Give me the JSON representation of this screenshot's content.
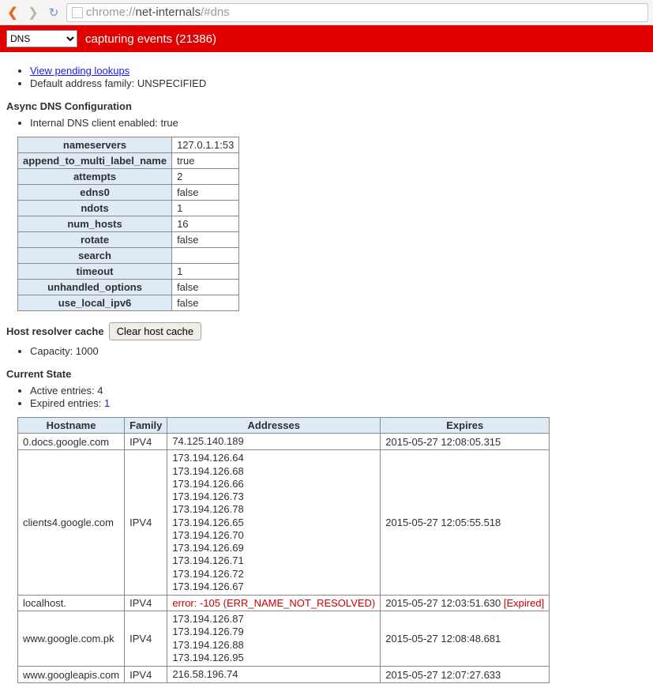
{
  "chrome_bar": {
    "url_grey": "chrome://",
    "url_dark": "net-internals",
    "url_rest": "/#dns"
  },
  "ribbon": {
    "select_value": "DNS",
    "status": "capturing events (21386)"
  },
  "top_list": {
    "link_pending": "View pending lookups",
    "family_line_prefix": "Default address family: ",
    "family_value": "UNSPECIFIED"
  },
  "async_heading": "Async DNS Configuration",
  "internal_client_line": "Internal DNS client enabled: true",
  "kv": [
    {
      "k": "nameservers",
      "v": "127.0.1.1:53"
    },
    {
      "k": "append_to_multi_label_name",
      "v": "true"
    },
    {
      "k": "attempts",
      "v": "2"
    },
    {
      "k": "edns0",
      "v": "false"
    },
    {
      "k": "ndots",
      "v": "1"
    },
    {
      "k": "num_hosts",
      "v": "16"
    },
    {
      "k": "rotate",
      "v": "false"
    },
    {
      "k": "search",
      "v": ""
    },
    {
      "k": "timeout",
      "v": "1"
    },
    {
      "k": "unhandled_options",
      "v": "false"
    },
    {
      "k": "use_local_ipv6",
      "v": "false"
    }
  ],
  "resolver": {
    "heading": "Host resolver cache",
    "button": "Clear host cache",
    "capacity_line": "Capacity: 1000"
  },
  "state_heading": "Current State",
  "entries": {
    "active_label": "Active entries: ",
    "active_val": "4",
    "expired_label": "Expired entries: ",
    "expired_val": "1"
  },
  "grid": {
    "headers": [
      "Hostname",
      "Family",
      "Addresses",
      "Expires"
    ],
    "rows": [
      {
        "host": "0.docs.google.com",
        "family": "IPV4",
        "addresses": [
          "74.125.140.189"
        ],
        "error": null,
        "expires": "2015-05-27 12:08:05.315",
        "expired": false
      },
      {
        "host": "clients4.google.com",
        "family": "IPV4",
        "addresses": [
          "173.194.126.64",
          "173.194.126.68",
          "173.194.126.66",
          "173.194.126.73",
          "173.194.126.78",
          "173.194.126.65",
          "173.194.126.70",
          "173.194.126.69",
          "173.194.126.71",
          "173.194.126.72",
          "173.194.126.67"
        ],
        "error": null,
        "expires": "2015-05-27 12:05:55.518",
        "expired": false
      },
      {
        "host": "localhost.",
        "family": "IPV4",
        "addresses": [],
        "error": "error: -105 (ERR_NAME_NOT_RESOLVED)",
        "expires": "2015-05-27 12:03:51.630",
        "expired": true
      },
      {
        "host": "www.google.com.pk",
        "family": "IPV4",
        "addresses": [
          "173.194.126.87",
          "173.194.126.79",
          "173.194.126.88",
          "173.194.126.95"
        ],
        "error": null,
        "expires": "2015-05-27 12:08:48.681",
        "expired": false
      },
      {
        "host": "www.googleapis.com",
        "family": "IPV4",
        "addresses": [
          "216.58.196.74"
        ],
        "error": null,
        "expires": "2015-05-27 12:07:27.633",
        "expired": false
      }
    ],
    "expired_tag": "[Expired]"
  }
}
